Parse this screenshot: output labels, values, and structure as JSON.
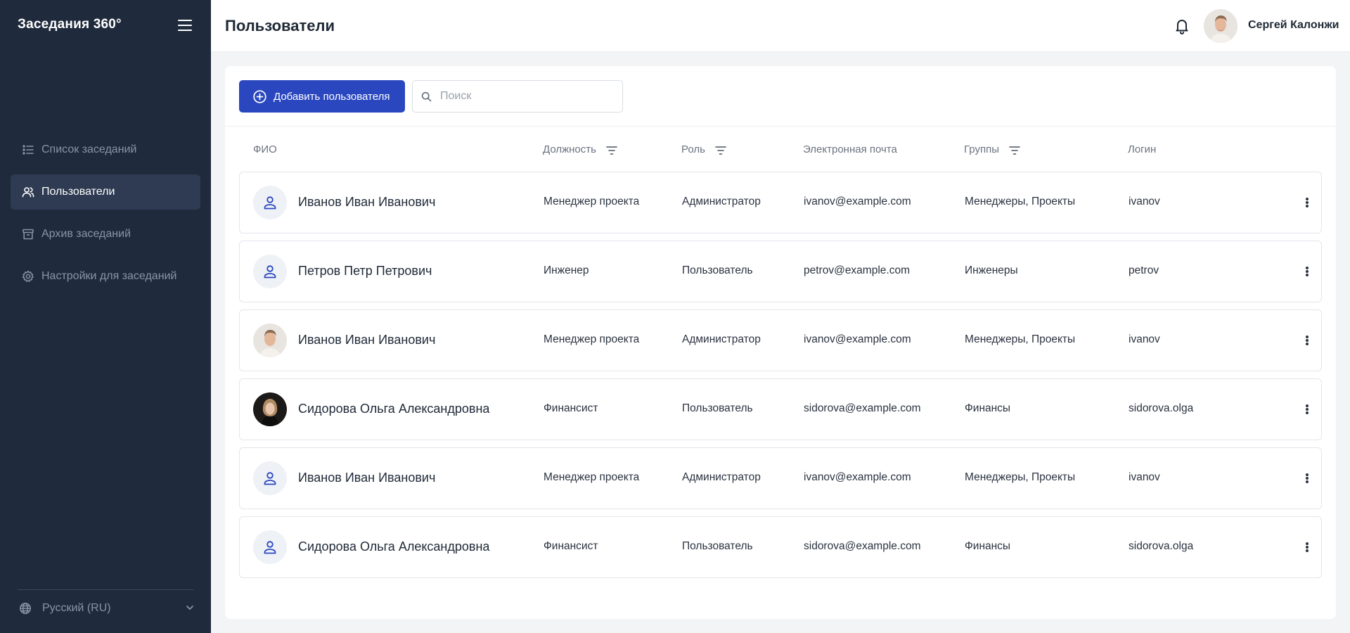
{
  "sidebar": {
    "brand": "Заседания 360°",
    "items": [
      {
        "label": "Список заседаний",
        "icon": "list-icon",
        "active": false
      },
      {
        "label": "Пользователи",
        "icon": "users-icon",
        "active": true
      },
      {
        "label": "Архив заседаний",
        "icon": "archive-icon",
        "active": false
      },
      {
        "label": "Настройки для заседаний",
        "icon": "gear-icon",
        "active": false
      }
    ],
    "language": "Русский (RU)"
  },
  "header": {
    "title": "Пользователи",
    "user_name": "Сергей Калонжи"
  },
  "toolbar": {
    "add_label": "Добавить пользователя",
    "search_placeholder": "Поиск",
    "search_value": ""
  },
  "table": {
    "columns": [
      "ФИО",
      "Должность",
      "Роль",
      "Электронная почта",
      "Группы",
      "Логин"
    ],
    "rows": [
      {
        "name": "Иванов Иван Иванович",
        "position": "Менеджер проекта",
        "role": "Администратор",
        "email": "ivanov@example.com",
        "groups": "Менеджеры, Проекты",
        "login": "ivanov",
        "avatar": "placeholder"
      },
      {
        "name": "Петров Петр Петрович",
        "position": "Инженер",
        "role": "Пользователь",
        "email": "petrov@example.com",
        "groups": "Инженеры",
        "login": "petrov",
        "avatar": "placeholder"
      },
      {
        "name": "Иванов Иван Иванович",
        "position": "Менеджер проекта",
        "role": "Администратор",
        "email": "ivanov@example.com",
        "groups": "Менеджеры, Проекты",
        "login": "ivanov",
        "avatar": "photo-man"
      },
      {
        "name": "Сидорова Ольга Александровна",
        "position": "Финансист",
        "role": "Пользователь",
        "email": "sidorova@example.com",
        "groups": "Финансы",
        "login": "sidorova.olga",
        "avatar": "photo-woman"
      },
      {
        "name": "Иванов Иван Иванович",
        "position": "Менеджер проекта",
        "role": "Администратор",
        "email": "ivanov@example.com",
        "groups": "Менеджеры, Проекты",
        "login": "ivanov",
        "avatar": "placeholder"
      },
      {
        "name": "Сидорова Ольга Александровна",
        "position": "Финансист",
        "role": "Пользователь",
        "email": "sidorova@example.com",
        "groups": "Финансы",
        "login": "sidorova.olga",
        "avatar": "placeholder"
      }
    ]
  },
  "colors": {
    "sidebar_bg": "#1f2a3c",
    "sidebar_active": "#2e3b52",
    "accent": "#2a47c0",
    "avatar_placeholder_bg": "#eef1f6"
  }
}
